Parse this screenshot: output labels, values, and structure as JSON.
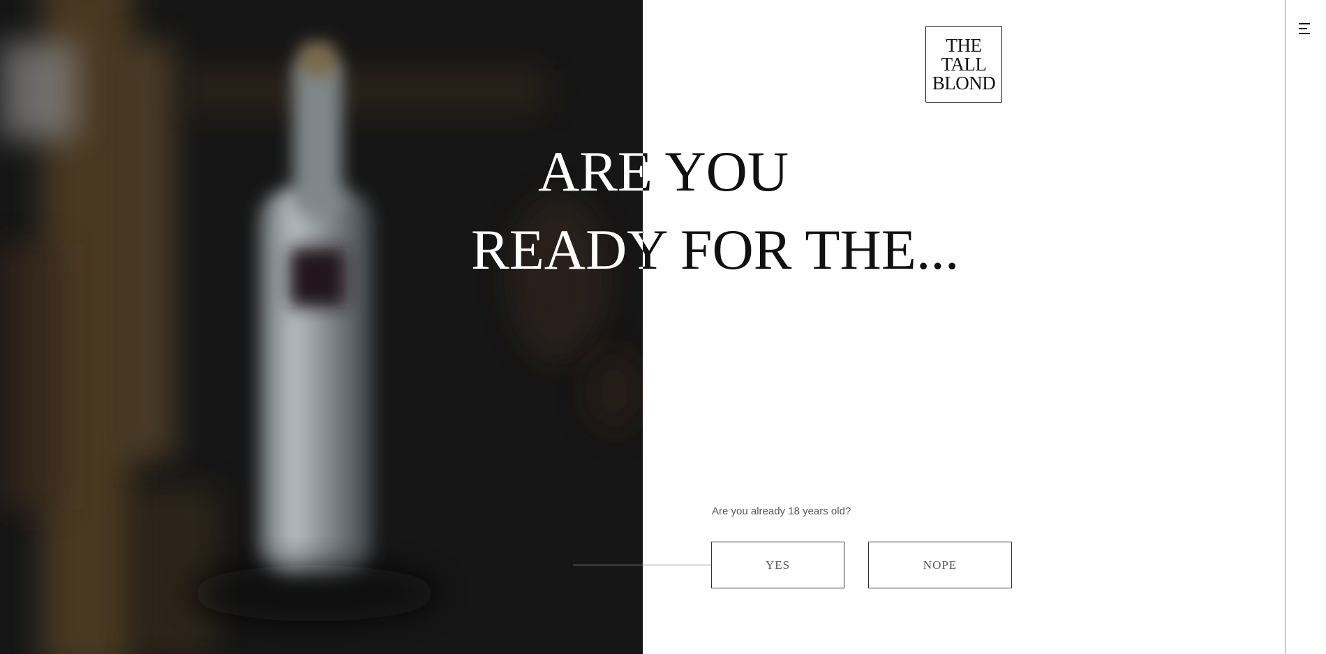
{
  "brand": {
    "logo_lines": [
      "THE",
      "TALL",
      "BLOND"
    ]
  },
  "headline": {
    "line1": "ARE YOU",
    "line2": "READY FOR THE..."
  },
  "age_gate": {
    "question": "Are you already 18 years old?",
    "yes_label": "YES",
    "no_label": "NOPE"
  },
  "icons": {
    "menu": "hamburger-menu-icon"
  },
  "colors": {
    "photo_background": "#161616",
    "page_background": "#ffffff",
    "text_dark": "#111111",
    "text_muted": "#555555"
  }
}
